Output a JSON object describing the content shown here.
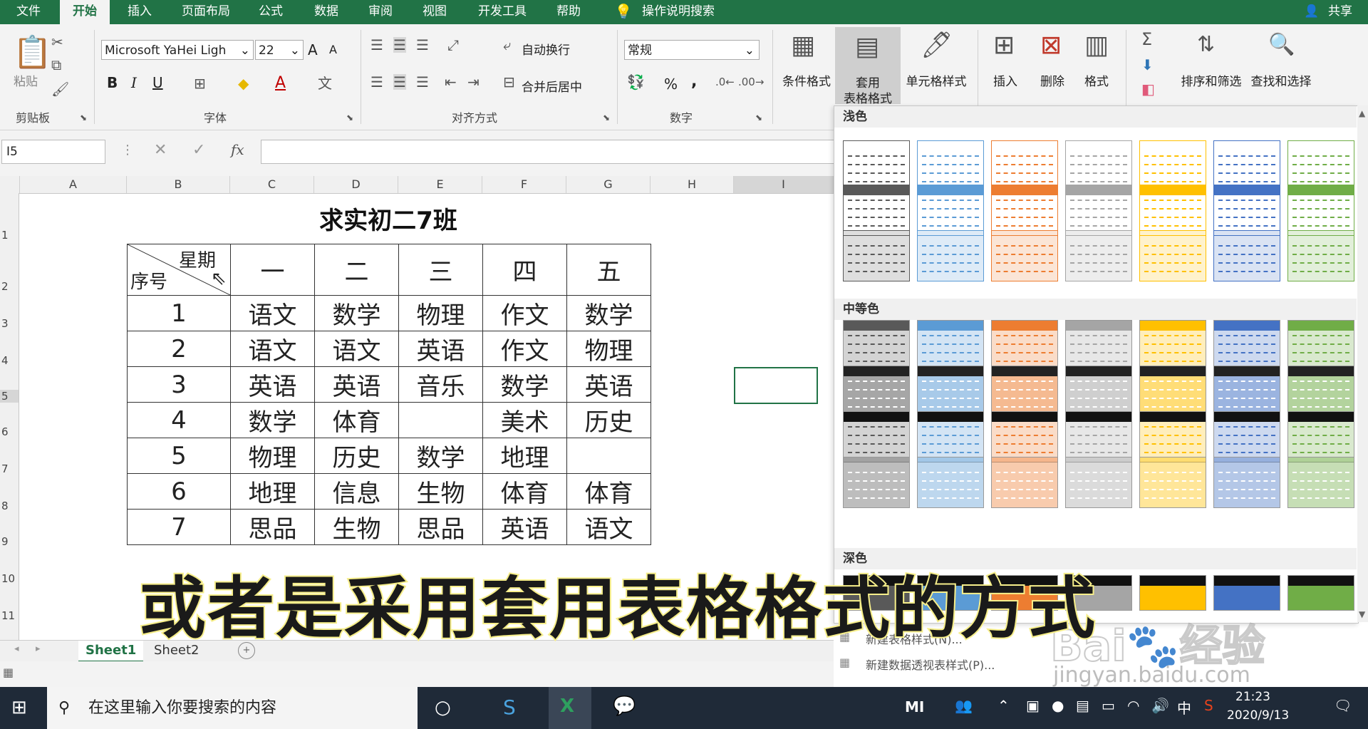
{
  "menu": {
    "tabs": [
      "文件",
      "开始",
      "插入",
      "页面布局",
      "公式",
      "数据",
      "审阅",
      "视图",
      "开发工具",
      "帮助"
    ],
    "search": "操作说明搜索",
    "share": "共享"
  },
  "ribbon": {
    "clipboard": {
      "paste": "粘贴",
      "label": "剪贴板"
    },
    "font": {
      "name": "Microsoft YaHei Ligh",
      "size": "22",
      "label": "字体",
      "bold": "B",
      "italic": "I",
      "underline": "U",
      "grow": "A",
      "shrink": "A",
      "color_a": "A"
    },
    "align": {
      "wrap": "自动换行",
      "merge": "合并后居中",
      "label": "对齐方式"
    },
    "number": {
      "format": "常规",
      "label": "数字",
      "percent": "%",
      "comma": ","
    },
    "styles": {
      "conditional": "条件格式",
      "table_l1": "套用",
      "table_l2": "表格格式",
      "cell": "单元格样式"
    },
    "cells": {
      "insert": "插入",
      "delete": "删除",
      "format": "格式"
    },
    "editing": {
      "sort": "排序和筛选",
      "find": "查找和选择"
    }
  },
  "formula": {
    "namebox": "I5",
    "fx": "fx"
  },
  "columns": [
    "A",
    "B",
    "C",
    "D",
    "E",
    "F",
    "G",
    "H",
    "I"
  ],
  "rows": [
    "1",
    "2",
    "3",
    "4",
    "5",
    "6",
    "7",
    "8",
    "9",
    "10",
    "11"
  ],
  "sheet": {
    "title": "求实初二7班",
    "corner_top": "星期",
    "corner_bottom": "序号",
    "days": [
      "一",
      "二",
      "三",
      "四",
      "五"
    ],
    "body": [
      [
        "1",
        "语文",
        "数学",
        "物理",
        "作文",
        "数学"
      ],
      [
        "2",
        "语文",
        "语文",
        "英语",
        "作文",
        "物理"
      ],
      [
        "3",
        "英语",
        "英语",
        "音乐",
        "数学",
        "英语"
      ],
      [
        "4",
        "数学",
        "体育",
        "",
        "美术",
        "历史"
      ],
      [
        "5",
        "物理",
        "历史",
        "数学",
        "地理",
        ""
      ],
      [
        "6",
        "地理",
        "信息",
        "生物",
        "体育",
        "体育"
      ],
      [
        "7",
        "思品",
        "生物",
        "思品",
        "英语",
        "语文"
      ]
    ]
  },
  "gallery": {
    "light": "浅色",
    "medium": "中等色",
    "dark": "深色",
    "new_table_style": "新建表格样式(N)...",
    "new_pivot_style": "新建数据透视表样式(P)...",
    "palette": [
      "#595959",
      "#5b9bd5",
      "#ed7d31",
      "#a5a5a5",
      "#ffc000",
      "#4472c4",
      "#70ad47"
    ]
  },
  "sheets": {
    "tab1": "Sheet1",
    "tab2": "Sheet2",
    "add": "+"
  },
  "subtitle": "或者是采用套用表格格式的方式",
  "watermark": {
    "brand": "Bai",
    "brand2": "经验",
    "url": "jingyan.baidu.com"
  },
  "taskbar": {
    "search": "在这里输入你要搜索的内容",
    "time": "21:23",
    "date": "2020/9/13",
    "ime": "中",
    "mi": "MI"
  }
}
